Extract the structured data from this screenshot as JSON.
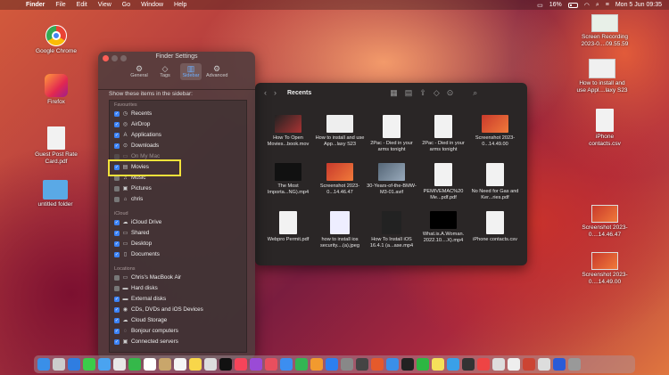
{
  "menubar": {
    "app": "Finder",
    "items": [
      "File",
      "Edit",
      "View",
      "Go",
      "Window",
      "Help"
    ],
    "battery": "16%",
    "datetime": "Mon 5 Jun  09:35"
  },
  "desktop_left": [
    {
      "label": "Google Chrome"
    },
    {
      "label": "Firefox"
    },
    {
      "label": "Guest Post Rate Card.pdf"
    },
    {
      "label": "untitled folder"
    }
  ],
  "desktop_right": [
    {
      "label": "Screen Recording 2023-0....09.55.59"
    },
    {
      "label": "How to install and use Appl....laxy S23"
    },
    {
      "label": "iPhone contacts.csv"
    },
    {
      "label": "Screenshot 2023-0....14.46.47"
    },
    {
      "label": "Screenshot 2023-0....14.49.00"
    }
  ],
  "finder": {
    "title": "Recents",
    "files": [
      {
        "name": "How To Open Movies...book.mov"
      },
      {
        "name": "How to install and use App...laxy S23"
      },
      {
        "name": "2Pac - Died in your arms tonight"
      },
      {
        "name": "2Pac - Died in your arms tonight"
      },
      {
        "name": "Screenshot 2023-0...14.49.00"
      },
      {
        "name": "The Most Importa...NG).mp4"
      },
      {
        "name": "Screenshot 2023-0...14.46.47"
      },
      {
        "name": "30-Years-of-the-BMW-M3-01.avif"
      },
      {
        "name": "PEMIVEMAC%20 Me...pdf.pdf"
      },
      {
        "name": "No Need for Gas and Ker...ries.pdf"
      },
      {
        "name": "Webpro Permit.pdf"
      },
      {
        "name": "how to install ios security....(a).jpeg"
      },
      {
        "name": "How To Install iOS 16.4.1 (a...ase.mp4"
      },
      {
        "name": "What.is.A.Woman. 2022.10....X).mp4"
      },
      {
        "name": "iPhone contacts.csv"
      }
    ]
  },
  "settings": {
    "title": "Finder Settings",
    "tabs": [
      {
        "label": "General",
        "icon": "gear-icon"
      },
      {
        "label": "Tags",
        "icon": "tag-icon"
      },
      {
        "label": "Sidebar",
        "icon": "sidebar-icon"
      },
      {
        "label": "Advanced",
        "icon": "gears-icon"
      }
    ],
    "show_label": "Show these items in the sidebar:",
    "sections": [
      {
        "title": "Favourites",
        "items": [
          {
            "label": "Recents",
            "checked": true
          },
          {
            "label": "AirDrop",
            "checked": true
          },
          {
            "label": "Applications",
            "checked": true
          },
          {
            "label": "Downloads",
            "checked": true
          },
          {
            "label": "On My Mac",
            "checked": false
          },
          {
            "label": "Movies",
            "checked": true
          },
          {
            "label": "Music",
            "checked": false
          },
          {
            "label": "Pictures",
            "checked": false
          },
          {
            "label": "chris",
            "checked": false
          }
        ]
      },
      {
        "title": "iCloud",
        "items": [
          {
            "label": "iCloud Drive",
            "checked": true
          },
          {
            "label": "Shared",
            "checked": true
          },
          {
            "label": "Desktop",
            "checked": true
          },
          {
            "label": "Documents",
            "checked": true
          }
        ]
      },
      {
        "title": "Locations",
        "items": [
          {
            "label": "Chris's MacBook Air",
            "checked": false
          },
          {
            "label": "Hard disks",
            "checked": false
          },
          {
            "label": "External disks",
            "checked": true
          },
          {
            "label": "CDs, DVDs and iOS Devices",
            "checked": true
          },
          {
            "label": "Cloud Storage",
            "checked": true
          },
          {
            "label": "Bonjour computers",
            "checked": true
          },
          {
            "label": "Connected servers",
            "checked": true
          }
        ]
      }
    ]
  },
  "colors": {
    "accent": "#3b82f6",
    "highlight": "#f3e23a"
  }
}
